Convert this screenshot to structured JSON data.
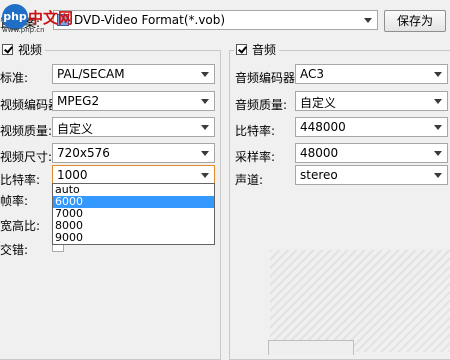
{
  "logo": {
    "php": "php",
    "cn": "中文网",
    "sub": "www.php.cn"
  },
  "preset": {
    "label": "置方案:",
    "value": "DVD-Video Format(*.vob)",
    "save_label": "保存为"
  },
  "video": {
    "title": "视频",
    "fields": [
      {
        "label": "标准:",
        "value": "PAL/SECAM"
      },
      {
        "label": "视频编码器:",
        "value": "MPEG2"
      },
      {
        "label": "视频质量:",
        "value": "自定义"
      },
      {
        "label": "视频尺寸:",
        "value": "720x576"
      },
      {
        "label": "比特率:",
        "value": "1000"
      }
    ],
    "hidden_labels": [
      "帧率:",
      "宽高比:",
      "交错:"
    ],
    "bitrate_options": [
      "auto",
      "6000",
      "7000",
      "8000",
      "9000"
    ],
    "bitrate_highlighted": "6000"
  },
  "audio": {
    "title": "音频",
    "fields": [
      {
        "label": "音频编码器:",
        "value": "AC3"
      },
      {
        "label": "音频质量:",
        "value": "自定义"
      },
      {
        "label": "比特率:",
        "value": "448000"
      },
      {
        "label": "采样率:",
        "value": "48000"
      },
      {
        "label": "声道:",
        "value": "stereo"
      }
    ]
  }
}
